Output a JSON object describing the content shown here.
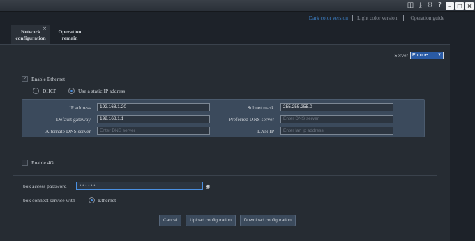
{
  "titlebar": {
    "icons": [
      "monitor-icon",
      "download-icon",
      "gear-icon",
      "help-icon"
    ],
    "window_buttons": [
      "minimize",
      "maximize",
      "close"
    ]
  },
  "toplinks": {
    "dark": "Dark color version",
    "light": "Light color version",
    "guide": "Operation guide"
  },
  "tabs": [
    {
      "line1": "Network",
      "line2": "configuration",
      "active": true,
      "close": "×"
    },
    {
      "line1": "Operation",
      "line2": "remain",
      "active": false
    }
  ],
  "server": {
    "label": "Server",
    "value": "Europe"
  },
  "ethernet": {
    "enable_label": "Enable Ethernet",
    "enabled": true,
    "dhcp_label": "DHCP",
    "static_label": "Use a static IP address",
    "selected": "static"
  },
  "network": {
    "ip_label": "IP address",
    "ip_value": "192.168.1.20",
    "mask_label": "Subnet mask",
    "mask_value": "255.255.255.0",
    "gateway_label": "Default gateway",
    "gateway_value": "192.168.1.1",
    "pdns_label": "Preferred DNS server",
    "pdns_placeholder": "Enter DNS server",
    "adns_label": "Alternate DNS server",
    "adns_placeholder": "Enter DNS server",
    "lanip_label": "LAN IP",
    "lanip_placeholder": "Enter lan ip address"
  },
  "fourg": {
    "enable_label": "Enable 4G",
    "enabled": false
  },
  "password": {
    "label": "box access password",
    "value": "••••••"
  },
  "connect": {
    "label": "box connect service with",
    "option": "Ethernet"
  },
  "buttons": {
    "cancel": "Cancel",
    "upload": "Upload configuration",
    "download": "Download configuration"
  },
  "colors": {
    "background": "#1d2229",
    "panel": "#262c33",
    "ip_box": "#3b4a5c",
    "accent": "#4a90e2",
    "link_active": "#3d7fc4"
  }
}
